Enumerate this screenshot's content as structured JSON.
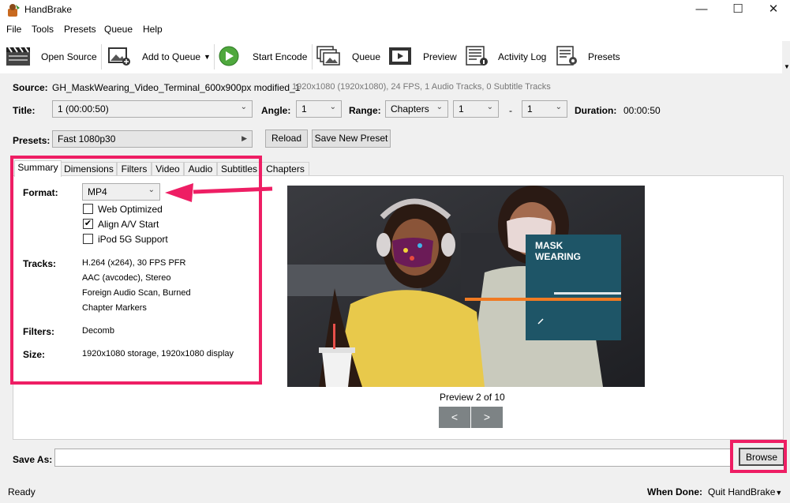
{
  "window": {
    "title": "HandBrake",
    "controls": {
      "minimize": "—",
      "maximize": "☐",
      "close": "✕"
    }
  },
  "menu": [
    "File",
    "Tools",
    "Presets",
    "Queue",
    "Help"
  ],
  "toolbar": {
    "open_source": "Open Source",
    "add_to_queue": "Add to Queue",
    "start_encode": "Start Encode",
    "queue": "Queue",
    "preview": "Preview",
    "activity_log": "Activity Log",
    "presets": "Presets"
  },
  "source": {
    "label": "Source:",
    "name": "GH_MaskWearing_Video_Terminal_600x900px modified_1",
    "info": "1920x1080 (1920x1080), 24 FPS, 1 Audio Tracks, 0 Subtitle Tracks"
  },
  "title_row": {
    "title_label": "Title:",
    "title_value": "1 (00:00:50)",
    "angle_label": "Angle:",
    "angle_value": "1",
    "range_label": "Range:",
    "range_type": "Chapters",
    "range_start": "1",
    "range_dash": "-",
    "range_end": "1",
    "duration_label": "Duration:",
    "duration_value": "00:00:50"
  },
  "presets_row": {
    "label": "Presets:",
    "value": "Fast 1080p30",
    "reload": "Reload",
    "save_new": "Save New Preset"
  },
  "tabs": [
    "Summary",
    "Dimensions",
    "Filters",
    "Video",
    "Audio",
    "Subtitles",
    "Chapters"
  ],
  "summary": {
    "format_label": "Format:",
    "format_value": "MP4",
    "web_optimized": {
      "label": "Web Optimized",
      "checked": false
    },
    "align_av": {
      "label": "Align A/V Start",
      "checked": true
    },
    "ipod": {
      "label": "iPod 5G Support",
      "checked": false
    },
    "tracks_label": "Tracks:",
    "tracks": [
      "H.264 (x264), 30 FPS PFR",
      "AAC (avcodec), Stereo",
      "Foreign Audio Scan, Burned",
      "Chapter Markers"
    ],
    "filters_label": "Filters:",
    "filters_value": "Decomb",
    "size_label": "Size:",
    "size_value": "1920x1080 storage, 1920x1080 display"
  },
  "preview": {
    "caption": "Preview 2 of 10",
    "prev": "<",
    "next": ">",
    "overlay_line1": "MASK",
    "overlay_line2": "WEARING"
  },
  "save_as": {
    "label": "Save As:",
    "value": "",
    "browse": "Browse"
  },
  "status": {
    "text": "Ready",
    "when_done_label": "When Done:",
    "when_done_value": "Quit HandBrake"
  },
  "colors": {
    "highlight": "#ee1e64",
    "accent_teal": "#1e5567",
    "accent_orange": "#f07a22"
  }
}
